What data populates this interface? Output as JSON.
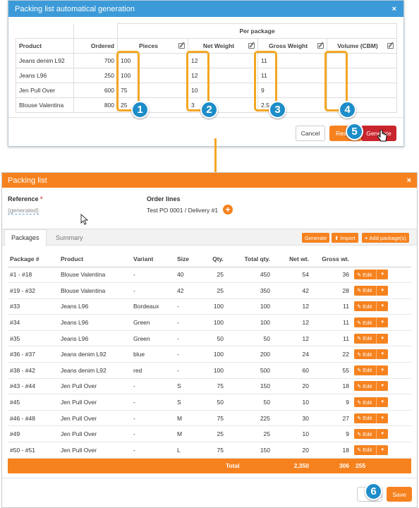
{
  "gen_dialog": {
    "title": "Packing list automatical generation",
    "close_icon": "×",
    "per_package_header": "Per package",
    "columns": [
      "Product",
      "Ordered",
      "Pieces",
      "Net Weight",
      "Gross Weight",
      "Volume (CBM)"
    ],
    "rows": [
      {
        "product": "Jeans denim L92",
        "ordered": "700",
        "pieces": "100",
        "net": "12",
        "gross": "11",
        "volume": ""
      },
      {
        "product": "Jeans L96",
        "ordered": "250",
        "pieces": "100",
        "net": "12",
        "gross": "11",
        "volume": ""
      },
      {
        "product": "Jen Pull Over",
        "ordered": "600",
        "pieces": "75",
        "net": "10",
        "gross": "9",
        "volume": ""
      },
      {
        "product": "Blouse Valentina",
        "ordered": "800",
        "pieces": "25",
        "net": "3",
        "gross": "2.5",
        "volume": ""
      }
    ],
    "cancel_label": "Cancel",
    "reset_label": "Res",
    "generate_label": "Generate"
  },
  "annotations": {
    "badges": [
      "1",
      "2",
      "3",
      "4",
      "5",
      "6"
    ],
    "highlight_color": "#f4a623",
    "badge_color": "#1d8dc9"
  },
  "packing_dialog": {
    "title": "Packing list",
    "close_icon": "×",
    "reference_label": "Reference",
    "required_mark": "*",
    "reference_value": "(generated)",
    "order_lines_label": "Order lines",
    "order_lines_value": "Test PO 0001 / Delivery #1",
    "add_order_icon": "+",
    "tabs": [
      "Packages",
      "Summary"
    ],
    "toolbar": {
      "generate_label": "Generate",
      "import_label": "Import",
      "add_label": "Add package(s)"
    },
    "columns": [
      "Package #",
      "Product",
      "Variant",
      "Size",
      "Qty.",
      "Total qty.",
      "Net wt.",
      "Gross wt."
    ],
    "rows": [
      {
        "pkg": "#1 - #18",
        "product": "Blouse Valentina",
        "variant": "-",
        "size": "40",
        "qty": "25",
        "total": "450",
        "net": "54",
        "gross": "36"
      },
      {
        "pkg": "#19 - #32",
        "product": "Blouse Valentina",
        "variant": "-",
        "size": "42",
        "qty": "25",
        "total": "350",
        "net": "42",
        "gross": "28"
      },
      {
        "pkg": "#33",
        "product": "Jeans L96",
        "variant": "Bordeaux",
        "size": "-",
        "qty": "100",
        "total": "100",
        "net": "12",
        "gross": "11"
      },
      {
        "pkg": "#34",
        "product": "Jeans L96",
        "variant": "Green",
        "size": "-",
        "qty": "100",
        "total": "100",
        "net": "12",
        "gross": "11"
      },
      {
        "pkg": "#35",
        "product": "Jeans L96",
        "variant": "Green",
        "size": "-",
        "qty": "50",
        "total": "50",
        "net": "12",
        "gross": "11"
      },
      {
        "pkg": "#36 - #37",
        "product": "Jeans denim L92",
        "variant": "blue",
        "size": "-",
        "qty": "100",
        "total": "200",
        "net": "24",
        "gross": "22"
      },
      {
        "pkg": "#38 - #42",
        "product": "Jeans denim L92",
        "variant": "red",
        "size": "-",
        "qty": "100",
        "total": "500",
        "net": "60",
        "gross": "55"
      },
      {
        "pkg": "#43 - #44",
        "product": "Jen Pull Over",
        "variant": "-",
        "size": "S",
        "qty": "75",
        "total": "150",
        "net": "20",
        "gross": "18"
      },
      {
        "pkg": "#45",
        "product": "Jen Pull Over",
        "variant": "-",
        "size": "S",
        "qty": "50",
        "total": "50",
        "net": "10",
        "gross": "9"
      },
      {
        "pkg": "#46 - #48",
        "product": "Jen Pull Over",
        "variant": "-",
        "size": "M",
        "qty": "75",
        "total": "225",
        "net": "30",
        "gross": "27"
      },
      {
        "pkg": "#49",
        "product": "Jen Pull Over",
        "variant": "-",
        "size": "M",
        "qty": "25",
        "total": "25",
        "net": "10",
        "gross": "9"
      },
      {
        "pkg": "#50 - #51",
        "product": "Jen Pull Over",
        "variant": "-",
        "size": "L",
        "qty": "75",
        "total": "150",
        "net": "20",
        "gross": "18"
      }
    ],
    "edit_label": "Edit",
    "total": {
      "label": "Total",
      "total_qty": "2,350",
      "net": "306",
      "gross": "255"
    },
    "save_label": "Save"
  },
  "colors": {
    "blue_header": "#3c9ad8",
    "orange": "#f6821f",
    "red_button": "#c9252c"
  }
}
